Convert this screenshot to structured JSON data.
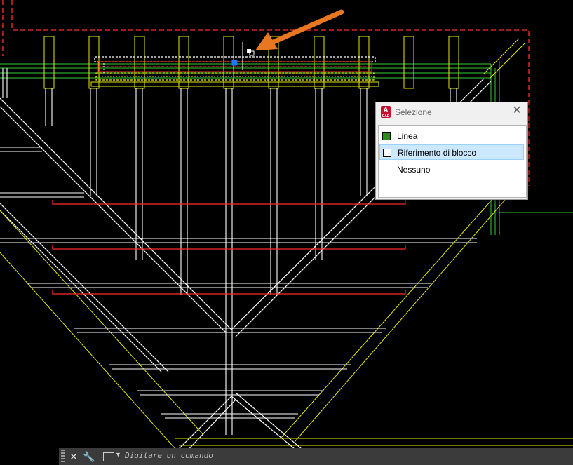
{
  "popup": {
    "title": "Selezione",
    "items": [
      {
        "label": "Linea",
        "color": "#2f8a1e"
      },
      {
        "label": "Riferimento di blocco",
        "color": "#ffffff"
      },
      {
        "label": "Nessuno",
        "color": ""
      }
    ],
    "selected_index": 1
  },
  "command_line": {
    "placeholder": "Digitare un comando"
  },
  "colors": {
    "background": "#000000",
    "white_lines": "#ffffff",
    "yellow_lines": "#e6e600",
    "green_lines": "#33cc33",
    "red_dashes": "#ff2a2a",
    "arrow": "#e87722",
    "selection_blue": "#1e7bff"
  },
  "icons": [
    "autocad-app-icon",
    "close-icon",
    "grip-icon",
    "close-x-icon",
    "wrench-icon",
    "command-prompt-icon",
    "dropdown-caret-icon",
    "cursor-pickbox-icon",
    "annotation-arrow-icon"
  ]
}
